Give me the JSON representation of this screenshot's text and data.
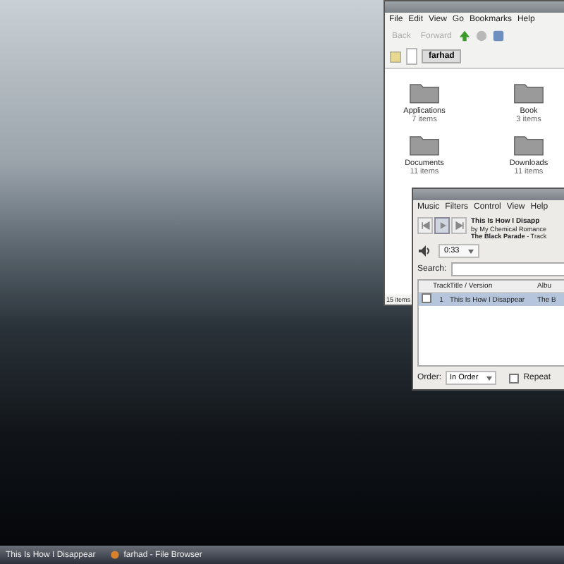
{
  "file_browser": {
    "menu": [
      "File",
      "Edit",
      "View",
      "Go",
      "Bookmarks",
      "Help"
    ],
    "toolbar": [
      {
        "label": "Back",
        "disabled": true
      },
      {
        "label": "Forward",
        "disabled": true
      }
    ],
    "location": "farhad",
    "items": [
      {
        "name": "Applications",
        "count": "7 items"
      },
      {
        "name": "Book",
        "count": "3 items"
      },
      {
        "name": "Documents",
        "count": "11 items"
      },
      {
        "name": "Downloads",
        "count": "11 items"
      }
    ],
    "status": "15 items"
  },
  "music_player": {
    "menu": [
      "Music",
      "Filters",
      "Control",
      "View",
      "Help"
    ],
    "controls": [
      {
        "kind": "previous",
        "pressed": false
      },
      {
        "kind": "play",
        "pressed": true
      },
      {
        "kind": "next",
        "pressed": false
      }
    ],
    "title": "This Is How I Disapp",
    "artist": "by My Chemical Romance",
    "album_line": "**The Black Parade** - Track",
    "time": "0:33",
    "search_label": "Search:",
    "columns": [
      "",
      "Track",
      "Title / Version",
      "Albu"
    ],
    "rows": [
      {
        "checked": false,
        "track": "1",
        "title": "This Is How I Disappear",
        "album": "The B",
        "selected": true
      }
    ],
    "order_label": "Order:",
    "order": "In Order",
    "repeat": {
      "label": "Repeat",
      "checked": false
    }
  },
  "taskbar": {
    "tasks": [
      {
        "label": "This Is How I Disappear",
        "icon": false
      },
      {
        "label": "farhad - File Browser",
        "icon": true
      }
    ]
  }
}
